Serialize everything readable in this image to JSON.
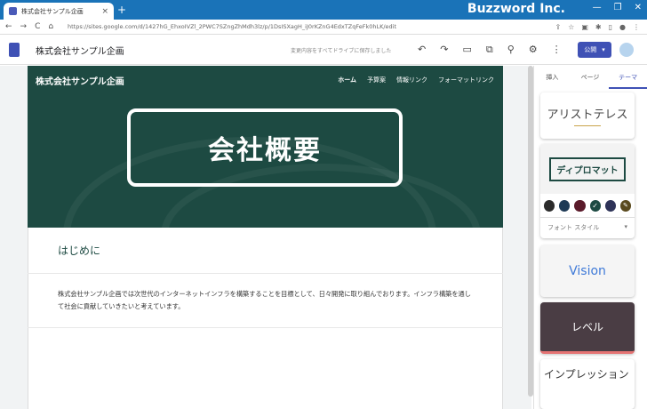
{
  "browser": {
    "tab_title": "株式会社サンプル企画",
    "tab_close": "×",
    "new_tab": "+",
    "brand": "Buzzword Inc.",
    "url": "https://sites.google.com/d/1427hG_EhxoIVZl_2PWC7SZngZhMdh3lz/p/1DsISXagH_iJ0rKZnG4EdxTZqFeFk0hLK/edit",
    "win_buttons": [
      "—",
      "❐",
      "✕"
    ],
    "nav": [
      "←",
      "→",
      "C",
      "⌂"
    ],
    "right_icons": [
      "⇪",
      "☆",
      "▣",
      "✱",
      "▯",
      "●",
      "⋮"
    ]
  },
  "appbar": {
    "site_title": "株式会社サンプル企画",
    "saved_status": "変更内容をすべてドライブに保存しました",
    "tools": [
      "↶",
      "↷",
      "▭",
      "⧉",
      "⚲",
      "⚙",
      "⋮"
    ],
    "publish_label": "公開",
    "publish_arrow": "▾"
  },
  "site": {
    "logo": "株式会社サンプル企画",
    "nav": [
      "ホーム",
      "予算案",
      "情報リンク",
      "フォーマットリンク"
    ],
    "hero_title": "会社概要",
    "section_heading": "はじめに",
    "body": "株式会社サンプル企画では次世代のインターネットインフラを構築することを目標として、日々開発に取り組んでおります。インフラ構築を通して社会に貢献していきたいと考えています。"
  },
  "panel": {
    "tabs": [
      "挿入",
      "ページ",
      "テーマ"
    ],
    "themes": {
      "aristotle": "アリストテレス",
      "diplomat": "ディプロマット",
      "font_style": "フォント スタイル",
      "font_arrow": "▾",
      "vision": "Vision",
      "level": "レベル",
      "impression": "インプレッション"
    },
    "swatch_colors": [
      "#2b2b2b",
      "#1e3a55",
      "#5a1a2a",
      "#1d4a42",
      "#2e3358",
      "#5a4a1e"
    ],
    "selected_swatch_mark": "✓",
    "custom_swatch_mark": "✎"
  }
}
